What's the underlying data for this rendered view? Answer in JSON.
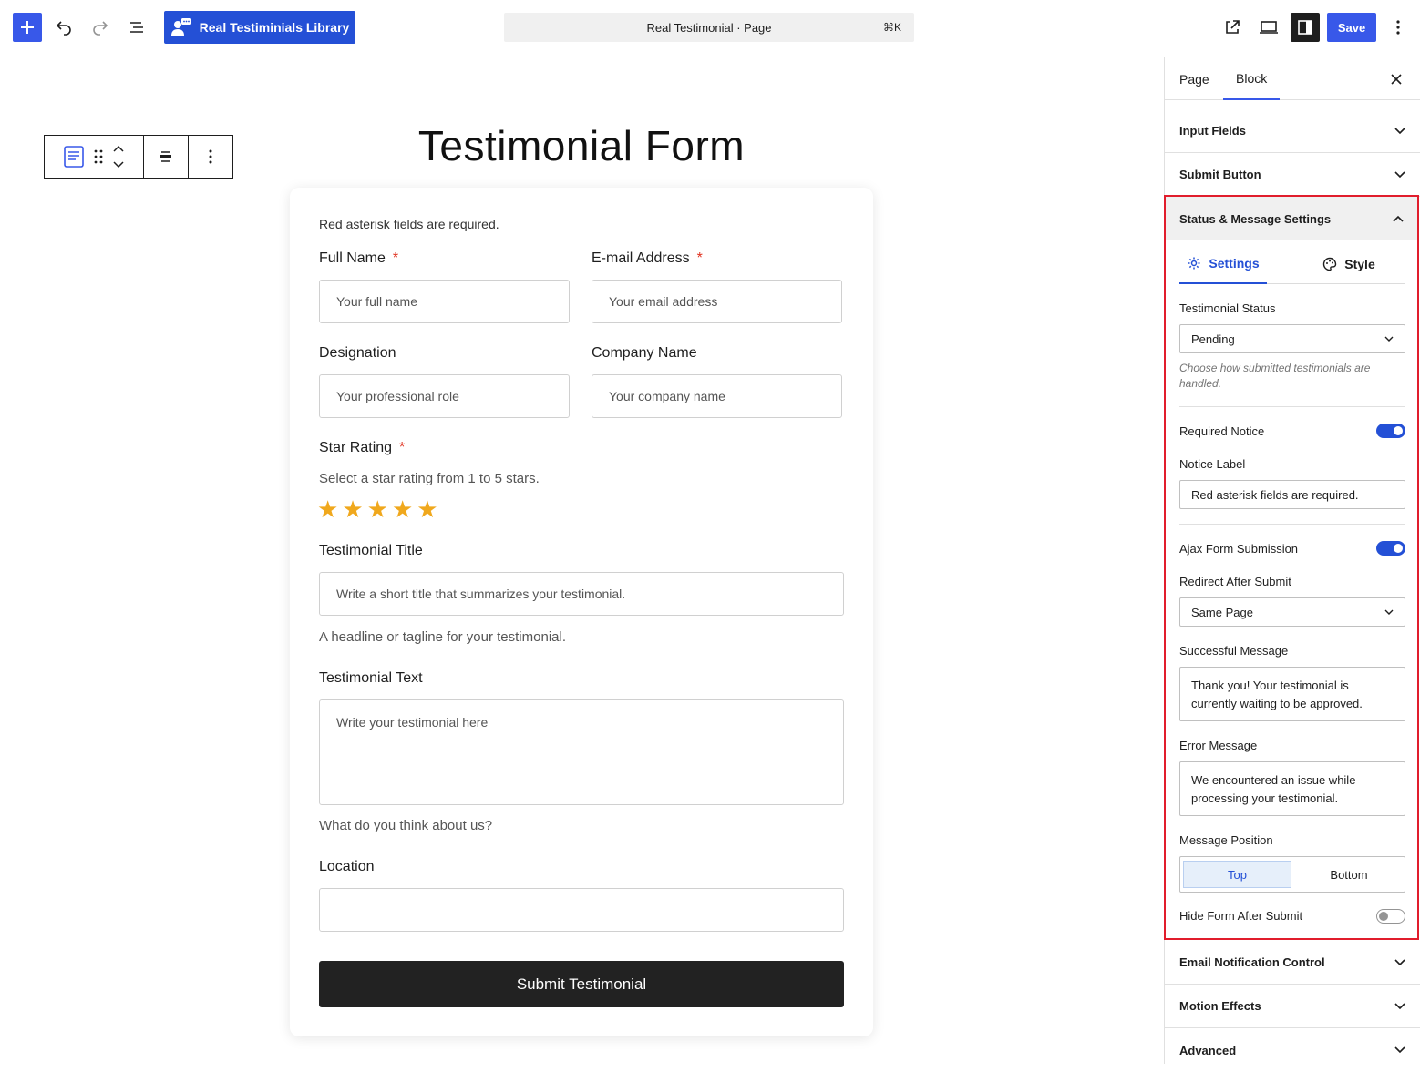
{
  "topbar": {
    "library_label": "Real Testiminials Library",
    "doc_title": "Real Testimonial · Page",
    "shortcut": "⌘K",
    "save_label": "Save"
  },
  "form": {
    "title": "Testimonial Form",
    "required_note": "Red asterisk fields are required.",
    "full_name": {
      "label": "Full Name",
      "placeholder": "Your full name"
    },
    "email": {
      "label": "E-mail Address",
      "placeholder": "Your email address"
    },
    "designation": {
      "label": "Designation",
      "placeholder": "Your professional role"
    },
    "company": {
      "label": "Company Name",
      "placeholder": "Your company name"
    },
    "star_rating": {
      "label": "Star Rating",
      "help": "Select a star rating from 1 to 5 stars.",
      "value": 5,
      "max": 5
    },
    "testimonial_title": {
      "label": "Testimonial Title",
      "placeholder": "Write a short title that summarizes your testimonial.",
      "help": "A headline or tagline for your testimonial."
    },
    "testimonial_text": {
      "label": "Testimonial Text",
      "placeholder": "Write your testimonial here",
      "help": "What do you think about us?"
    },
    "location": {
      "label": "Location",
      "placeholder": ""
    },
    "submit_label": "Submit Testimonial",
    "required_mark": "*"
  },
  "sidebar": {
    "tabs": [
      "Page",
      "Block"
    ],
    "active_tab": "Block",
    "panels_top": [
      "Input Fields",
      "Submit Button"
    ],
    "status_panel": {
      "title": "Status & Message Settings",
      "subtabs": [
        "Settings",
        "Style"
      ],
      "active_subtab": "Settings",
      "testimonial_status_label": "Testimonial Status",
      "testimonial_status_value": "Pending",
      "testimonial_status_help": "Choose how submitted testimonials are handled.",
      "required_notice_label": "Required Notice",
      "required_notice_on": true,
      "notice_label_label": "Notice Label",
      "notice_label_value": "Red asterisk fields are required.",
      "ajax_label": "Ajax Form Submission",
      "ajax_on": true,
      "redirect_label": "Redirect After Submit",
      "redirect_value": "Same Page",
      "success_label": "Successful Message",
      "success_value": "Thank you! Your testimonial is currently waiting to be approved.",
      "error_label": "Error Message",
      "error_value": "We encountered an issue while processing your testimonial.",
      "position_label": "Message Position",
      "position_options": [
        "Top",
        "Bottom"
      ],
      "position_selected": "Top",
      "hide_form_label": "Hide Form After Submit",
      "hide_form_on": false
    },
    "panels_bottom": [
      "Email Notification Control",
      "Motion Effects",
      "Advanced"
    ]
  },
  "colors": {
    "accent": "#3858e9",
    "library_button": "#2450d6",
    "highlight_border": "#e11d2c",
    "star": "#f0a81d",
    "submit_bg": "#222222"
  },
  "icons": [
    "plus-icon",
    "undo-icon",
    "redo-icon",
    "document-overview-icon",
    "user-chat-icon",
    "external-link-icon",
    "device-preview-icon",
    "sidebar-icon",
    "kebab-icon",
    "close-icon",
    "chevron-down-icon",
    "chevron-up-icon",
    "gear-icon",
    "palette-icon",
    "drag-handle-icon",
    "block-form-icon",
    "align-icon"
  ]
}
